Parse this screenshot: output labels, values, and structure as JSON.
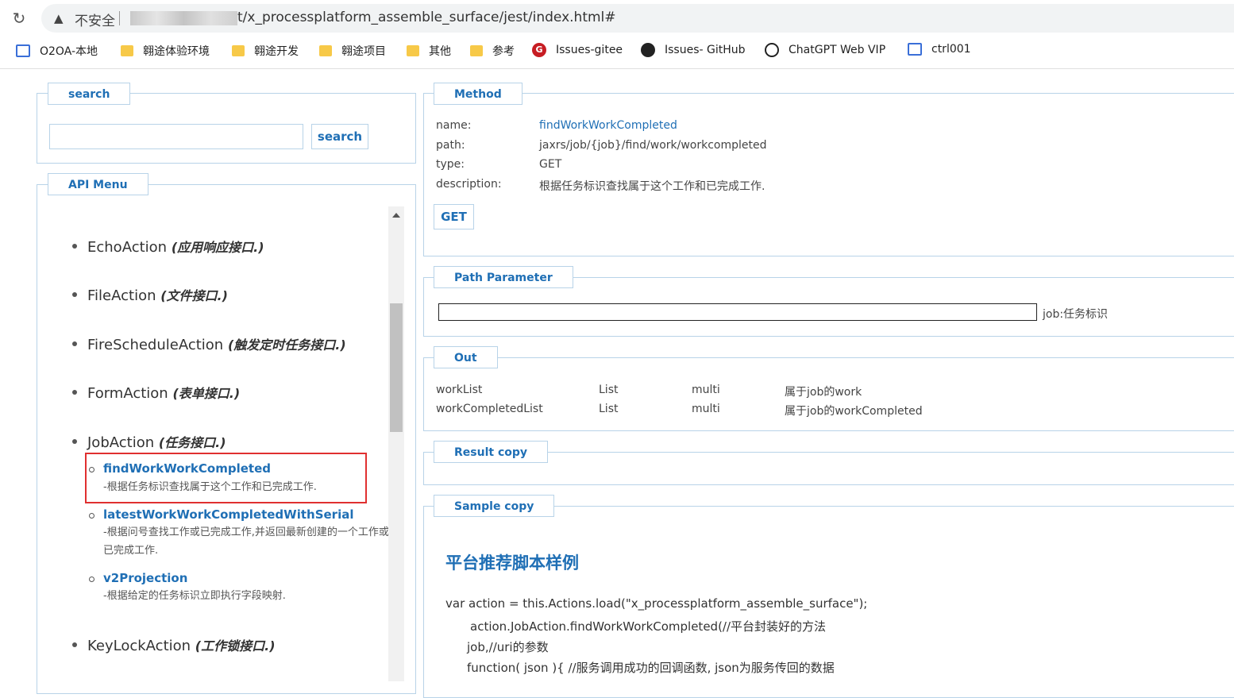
{
  "browser": {
    "insecure_label": "不安全",
    "url_visible": "t/x_processplatform_assemble_surface/jest/index.html#",
    "bookmarks": [
      {
        "label": "O2OA-本地",
        "icon": "o2-icon"
      },
      {
        "label": "翱途体验环境",
        "icon": "folder-icon"
      },
      {
        "label": "翱途开发",
        "icon": "folder-icon"
      },
      {
        "label": "翱途项目",
        "icon": "folder-icon"
      },
      {
        "label": "其他",
        "icon": "folder-icon"
      },
      {
        "label": "参考",
        "icon": "folder-icon"
      },
      {
        "label": "Issues-gitee",
        "icon": "gitee-icon"
      },
      {
        "label": "Issues- GitHub",
        "icon": "github-icon"
      },
      {
        "label": "ChatGPT Web VIP",
        "icon": "chatgpt-icon"
      },
      {
        "label": "ctrl001",
        "icon": "o2-icon"
      }
    ]
  },
  "search": {
    "legend": "search",
    "input_value": "",
    "button_label": "search"
  },
  "menu": {
    "legend": "API Menu",
    "items": [
      {
        "name": "EchoAction",
        "desc": "(应用响应接口.)"
      },
      {
        "name": "FileAction",
        "desc": "(文件接口.)"
      },
      {
        "name": "FireScheduleAction",
        "desc": "(触发定时任务接口.)"
      },
      {
        "name": "FormAction",
        "desc": "(表单接口.)"
      },
      {
        "name": "JobAction",
        "desc": "(任务接口.)"
      },
      {
        "name": "KeyLockAction",
        "desc": "(工作锁接口.)"
      }
    ],
    "job_subitems": [
      {
        "title": "findWorkWorkCompleted",
        "desc": "-根据任务标识查找属于这个工作和已完成工作."
      },
      {
        "title": "latestWorkWorkCompletedWithSerial",
        "desc": "-根据问号查找工作或已完成工作,并返回最新创建的一个工作或已完成工作."
      },
      {
        "title": "v2Projection",
        "desc": "-根据给定的任务标识立即执行字段映射."
      }
    ]
  },
  "method": {
    "legend": "Method",
    "name_label": "name:",
    "name_value": "findWorkWorkCompleted",
    "path_label": "path:",
    "path_value": "jaxrs/job/{job}/find/work/workcompleted",
    "type_label": "type:",
    "type_value": "GET",
    "description_label": "description:",
    "description_value": "根据任务标识查找属于这个工作和已完成工作.",
    "button_label": "GET"
  },
  "path_parameter": {
    "legend": "Path Parameter",
    "input_value": "",
    "param_label": "job:任务标识"
  },
  "out": {
    "legend": "Out",
    "rows": [
      {
        "name": "workList",
        "type": "List",
        "mode": "multi",
        "desc": "属于job的work"
      },
      {
        "name": "workCompletedList",
        "type": "List",
        "mode": "multi",
        "desc": "属于job的workCompleted"
      }
    ]
  },
  "result": {
    "legend": "Result copy"
  },
  "sample": {
    "legend": "Sample copy",
    "heading": "平台推荐脚本样例",
    "lines": [
      "var action = this.Actions.load(\"x_processplatform_assemble_surface\");",
      "action.JobAction.findWorkWorkCompleted(//平台封装好的方法",
      "job,//uri的参数",
      "function( json ){ //服务调用成功的回调函数, json为服务传回的数据"
    ]
  }
}
